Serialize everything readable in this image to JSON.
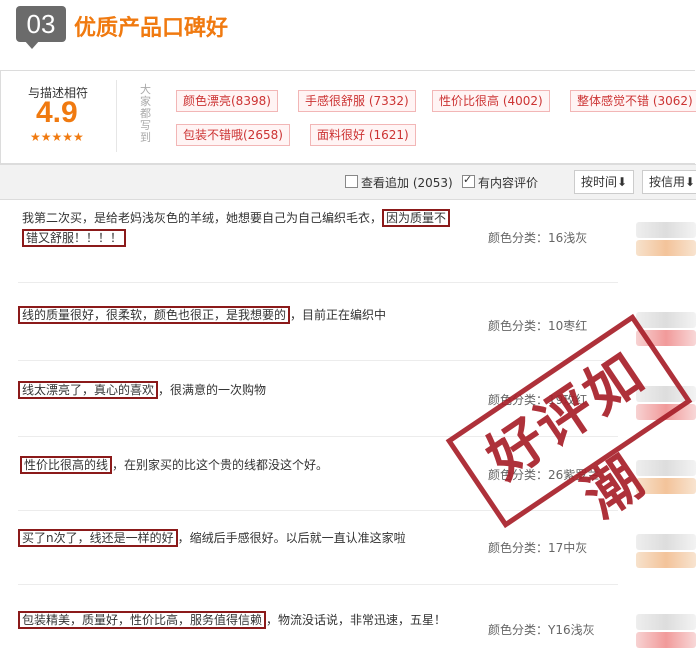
{
  "section": {
    "number": "03",
    "title": "优质产品口碑好"
  },
  "summary": {
    "match_label": "与描述相符",
    "score": "4.9",
    "stars": "★★★★★",
    "side_label": "大家都写到",
    "tags": [
      "颜色漂亮(8398)",
      "手感很舒服 (7332)",
      "性价比很高 (4002)",
      "整体感觉不错 (3062)",
      "包装不错哦(2658)",
      "面料很好 (1621)"
    ]
  },
  "toolbar": {
    "follow_up_label": "查看追加 (2053)",
    "content_label": "有内容评价",
    "sort_time": "按时间",
    "sort_credit": "按信用",
    "arrow": "⬇"
  },
  "reviews": [
    {
      "highlight": "因为质量不",
      "text_before": "我第二次买，是给老妈浅灰色的羊绒，她想要自己为自己编织毛衣，",
      "highlight_line2": "错又舒服！！！！",
      "text_after": "",
      "color_category": "颜色分类：16浅灰"
    },
    {
      "highlight": "线的质量很好，很柔软，颜色也很正，是我想要的",
      "text_after": "，目前正在编织中",
      "color_category": "颜色分类：10枣红"
    },
    {
      "highlight": "线太漂亮了，真心的喜欢",
      "text_after": "，很满意的一次购物",
      "color_category": "颜色分类：19玫红"
    },
    {
      "highlight": "性价比很高的线",
      "text_after": "，在别家买的比这个贵的线都没这个好。",
      "color_category": "颜色分类：26紫罗兰"
    },
    {
      "highlight": "买了n次了，线还是一样的好",
      "text_after": "，缩绒后手感很好。以后就一直认准这家啦",
      "color_category": "颜色分类：17中灰"
    },
    {
      "highlight": "包装精美，质量好，性价比高，服务值得信赖",
      "text_after": "，物流没话说，非常迅速，五星！",
      "color_category": "颜色分类：Y16浅灰"
    }
  ],
  "stamp_text": "好评如潮"
}
